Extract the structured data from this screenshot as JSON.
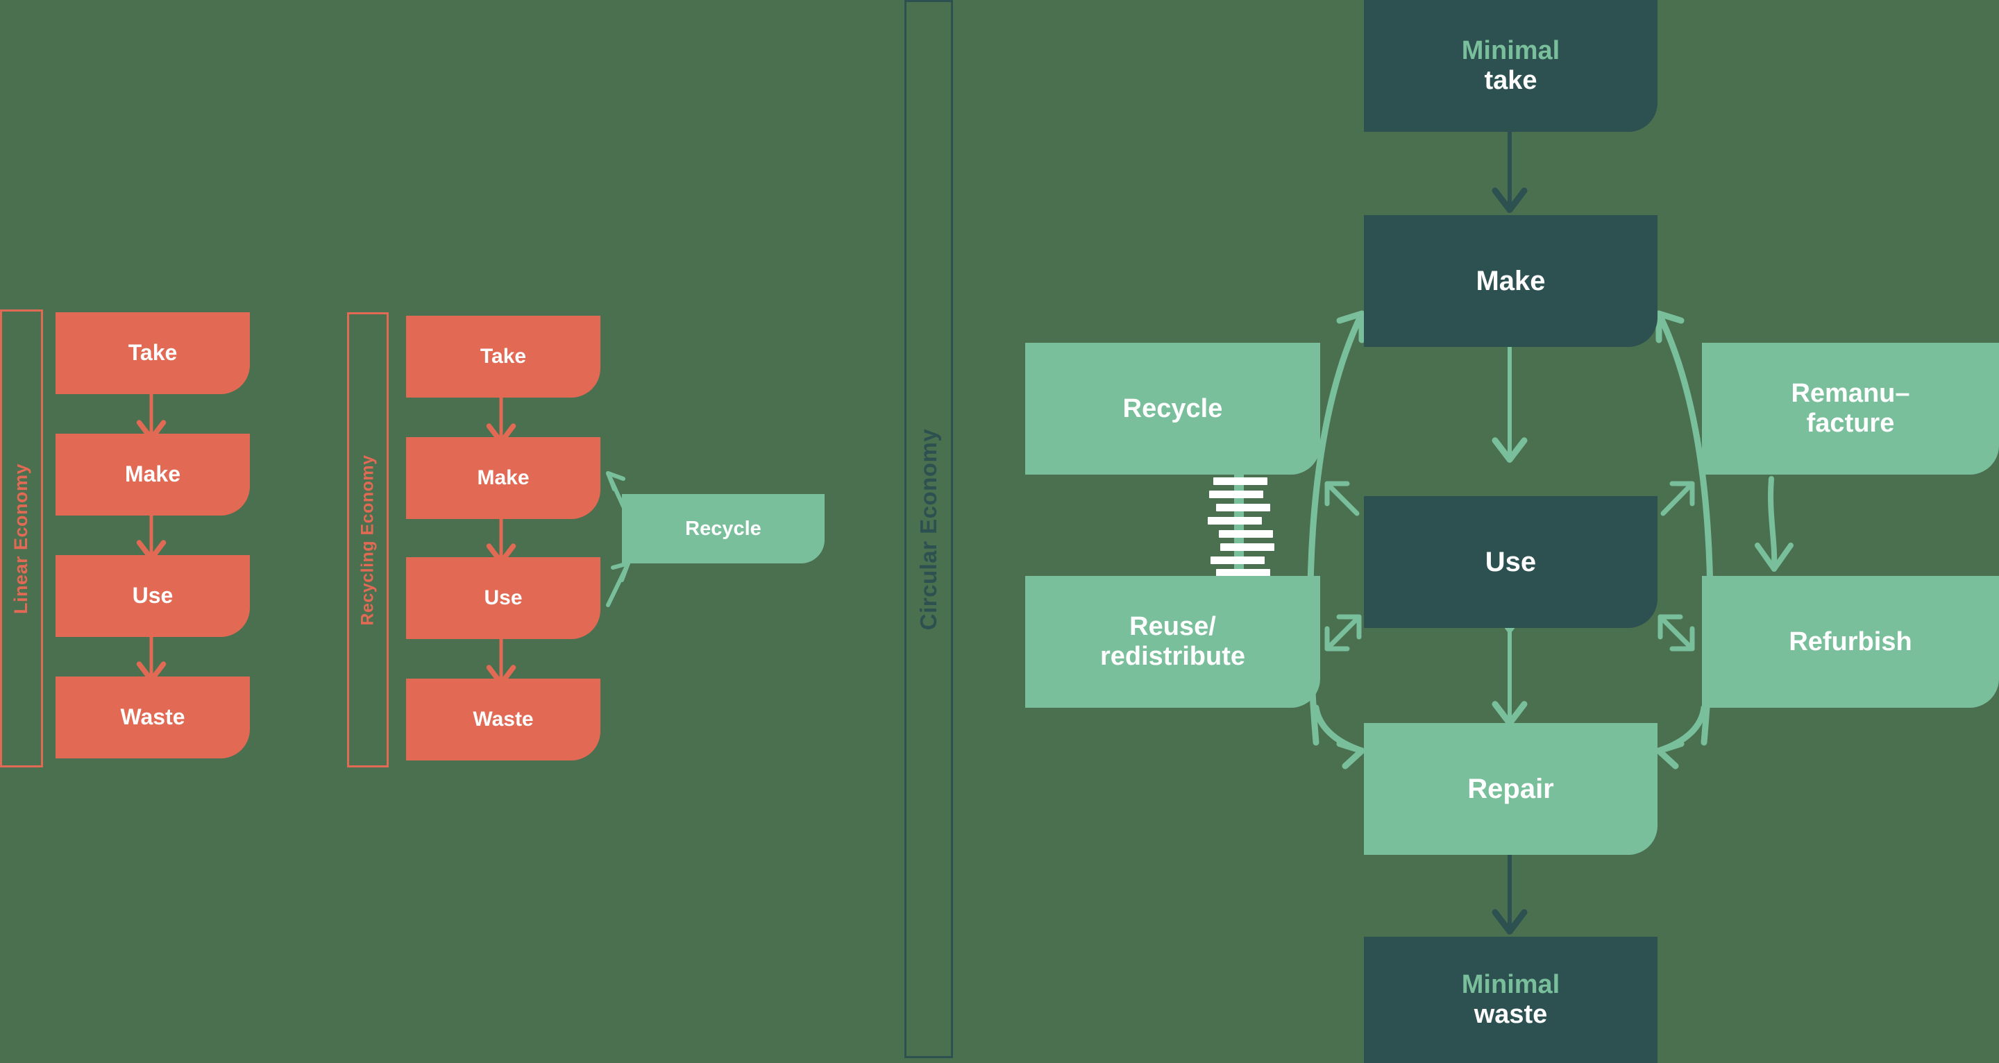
{
  "diagram": {
    "title": "Linear, recycling and circular economy comparison",
    "background_color": "#4A7050",
    "palette": {
      "red": "#E26A54",
      "dark_teal": "#2D5050",
      "mint": "#79BF9B",
      "white": "#FFFFFF"
    }
  },
  "panels": {
    "linear": {
      "label": "Linear Economy",
      "label_color": "#E26A54",
      "steps": [
        {
          "label": "Take"
        },
        {
          "label": "Make"
        },
        {
          "label": "Use"
        },
        {
          "label": "Waste"
        }
      ]
    },
    "recycling": {
      "label": "Recycling Economy",
      "label_color": "#E26A54",
      "steps": [
        {
          "label": "Take"
        },
        {
          "label": "Make"
        },
        {
          "label": "Use"
        },
        {
          "label": "Waste"
        }
      ],
      "loop": {
        "label": "Recycle"
      }
    },
    "circular": {
      "label": "Circular Economy",
      "label_color": "#2D5050",
      "top": {
        "line1": "Minimal",
        "line2": "take"
      },
      "bottom": {
        "line1": "Minimal",
        "line2": "waste"
      },
      "core": [
        {
          "label": "Make"
        },
        {
          "label": "Use"
        },
        {
          "label": "Repair"
        }
      ],
      "left_loops": [
        {
          "label": "Recycle"
        },
        {
          "line1": "Reuse/",
          "line2": "redistribute"
        }
      ],
      "right_loops": [
        {
          "line1": "Remanu–",
          "line2": "facture"
        },
        {
          "label": "Refurbish"
        }
      ]
    }
  }
}
